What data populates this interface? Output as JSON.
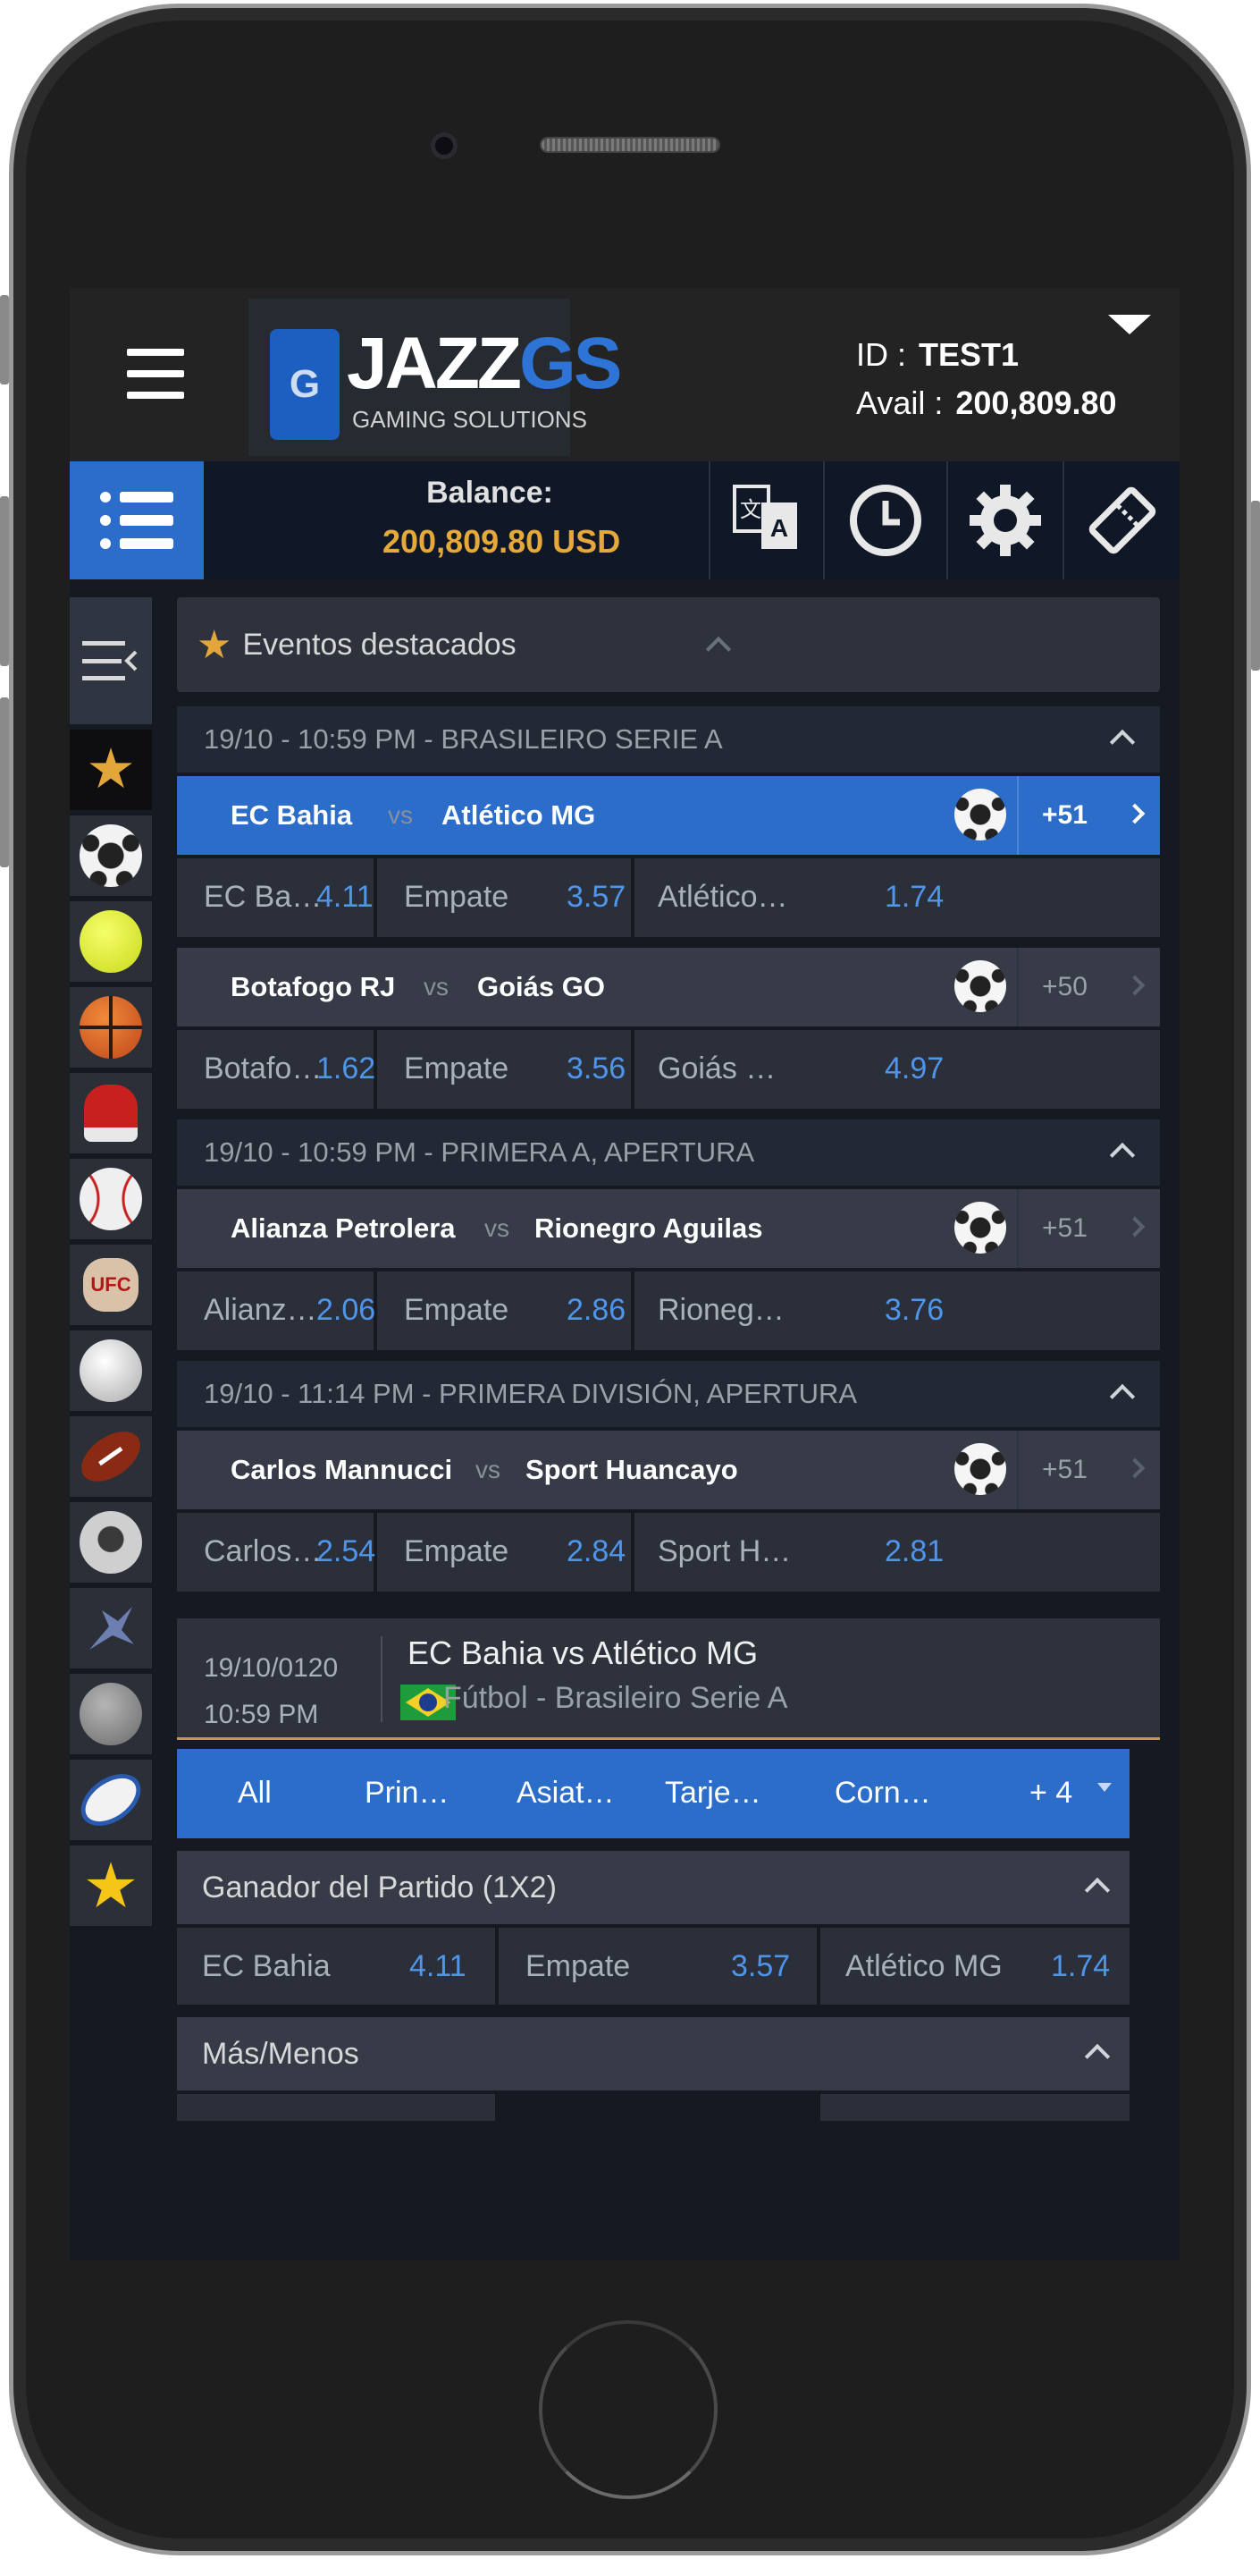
{
  "header": {
    "logo_main": "JAZZ",
    "logo_accent": "GS",
    "logo_sub": "GAMING SOLUTIONS",
    "id_label": "ID :",
    "id_value": "TEST1",
    "avail_label": "Avail :",
    "avail_value": "200,809.80"
  },
  "toolbar": {
    "balance_label": "Balance:",
    "balance_value": "200,809.80 USD",
    "icons": [
      "language-icon",
      "clock-icon",
      "gear-icon",
      "ticket-icon"
    ]
  },
  "sidebar": {
    "items": [
      "collapse-menu-icon",
      "star-icon",
      "soccer-icon",
      "tennis-icon",
      "basketball-icon",
      "boxing-icon",
      "baseball-icon",
      "ufc-icon",
      "volleyball-icon",
      "american-football-icon",
      "hockey-icon",
      "esports-icon",
      "ball-icon",
      "rugby-icon",
      "favorites-star-icon"
    ]
  },
  "featured": {
    "title": "Eventos destacados",
    "groups": [
      {
        "header": "19/10 - 10:59 PM - BRASILEIRO SERIE A",
        "matches": [
          {
            "home": "EC Bahia",
            "vs": "vs",
            "away": "Atlético MG",
            "more": "+51",
            "selected": true,
            "odds": [
              {
                "name": "EC Bahia",
                "price": "4.11"
              },
              {
                "name": "Empate",
                "price": "3.57"
              },
              {
                "name": "Atlético MG",
                "price": "1.74"
              }
            ]
          },
          {
            "home": "Botafogo RJ",
            "vs": "vs",
            "away": "Goiás GO",
            "more": "+50",
            "selected": false,
            "odds": [
              {
                "name": "Botafogo RJ",
                "price": "1.62"
              },
              {
                "name": "Empate",
                "price": "3.56"
              },
              {
                "name": "Goiás GO",
                "price": "4.97"
              }
            ]
          }
        ]
      },
      {
        "header": "19/10 - 10:59 PM - PRIMERA A, APERTURA",
        "matches": [
          {
            "home": "Alianza Petrolera",
            "vs": "vs",
            "away": "Rionegro Aguilas",
            "more": "+51",
            "selected": false,
            "odds": [
              {
                "name": "Alianza Petr…",
                "price": "2.06"
              },
              {
                "name": "Empate",
                "price": "2.86"
              },
              {
                "name": "Rionegro A…",
                "price": "3.76"
              }
            ]
          }
        ]
      },
      {
        "header": "19/10 - 11:14 PM - PRIMERA DIVISIÓN, APERTURA",
        "matches": [
          {
            "home": "Carlos Mannucci",
            "vs": "vs",
            "away": "Sport Huancayo",
            "more": "+51",
            "selected": false,
            "odds": [
              {
                "name": "Carlos Man…",
                "price": "2.54"
              },
              {
                "name": "Empate",
                "price": "2.84"
              },
              {
                "name": "Sport Huan…",
                "price": "2.81"
              }
            ]
          }
        ]
      }
    ]
  },
  "detail": {
    "code": "19/10/0120",
    "time": "10:59 PM",
    "title": "EC Bahia vs Atlético MG",
    "league": "Fútbol - Brasileiro Serie A"
  },
  "tabs": [
    "All",
    "Prin…",
    "Asiat…",
    "Tarje…",
    "Corn…",
    "+ 4"
  ],
  "markets": [
    {
      "title": "Ganador del Partido (1X2)",
      "odds": [
        {
          "name": "EC Bahia",
          "price": "4.11"
        },
        {
          "name": "Empate",
          "price": "3.57"
        },
        {
          "name": "Atlético MG",
          "price": "1.74"
        }
      ]
    },
    {
      "title": "Más/Menos"
    }
  ]
}
